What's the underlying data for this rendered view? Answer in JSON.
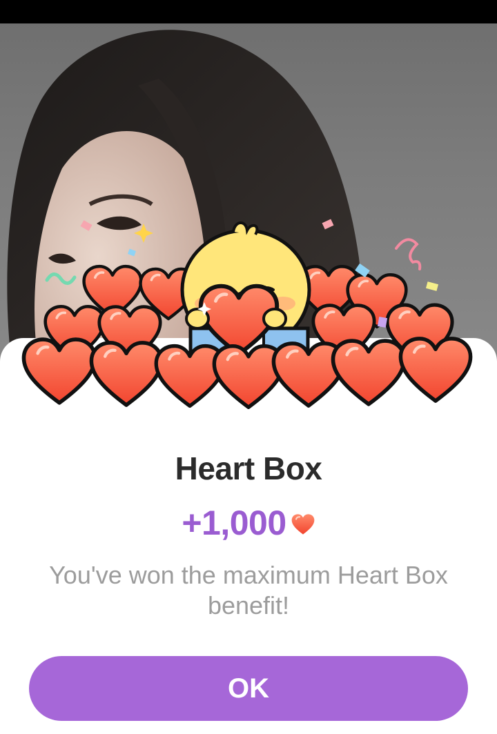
{
  "dialog": {
    "title": "Heart Box",
    "reward_amount": "+1,000",
    "message": "You've won the maximum Heart Box benefit!",
    "ok_label": "OK"
  },
  "icons": {
    "reward": "heart-icon",
    "illustration": "chick-holding-heart-illustration"
  },
  "colors": {
    "accent": "#a667d8",
    "reward_text": "#9a5cd1",
    "title_text": "#2b2b2b",
    "message_text": "#9c9c9c",
    "heart": "#f4553a"
  }
}
